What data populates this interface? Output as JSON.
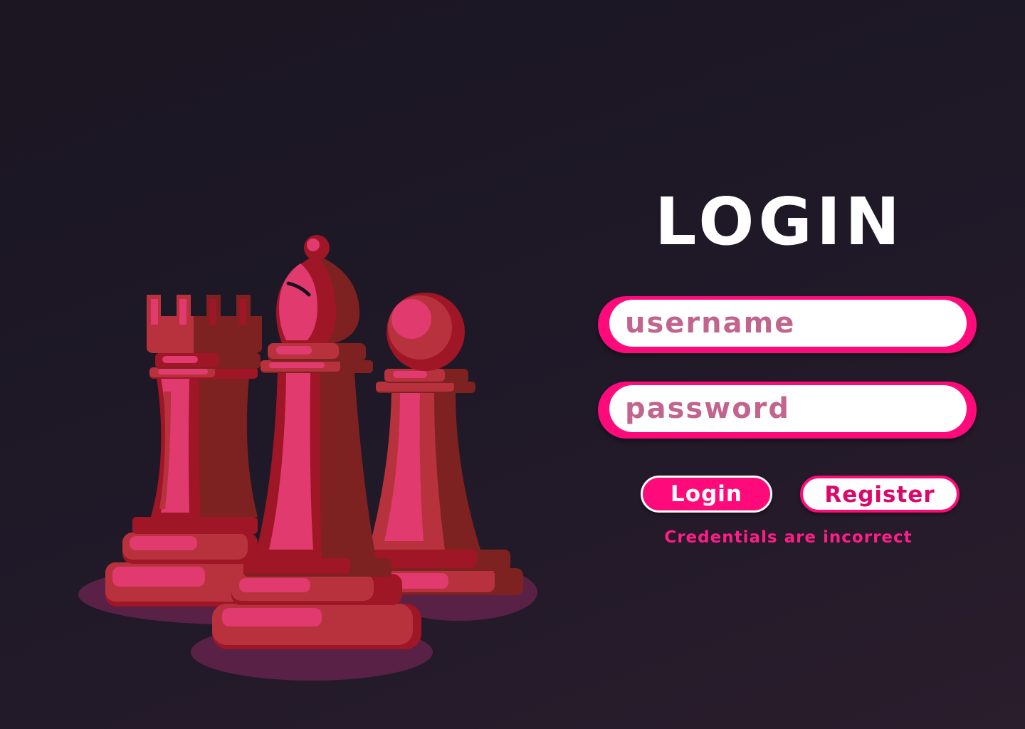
{
  "login_form": {
    "title": "LOGIN",
    "username_placeholder": "username",
    "password_placeholder": "password",
    "login_button_label": "Login",
    "register_button_label": "Register",
    "error_message": "Credentials are incorrect"
  },
  "illustration": {
    "pieces": [
      "rook-icon",
      "bishop-icon",
      "pawn-icon"
    ]
  },
  "colors": {
    "background": "#1e1827",
    "accent": "#ff0a7a",
    "piece_light": "#e03a6e",
    "piece_dark": "#9f1626",
    "piece_shadow": "#5a2146",
    "placeholder_text": "#c2658e"
  }
}
